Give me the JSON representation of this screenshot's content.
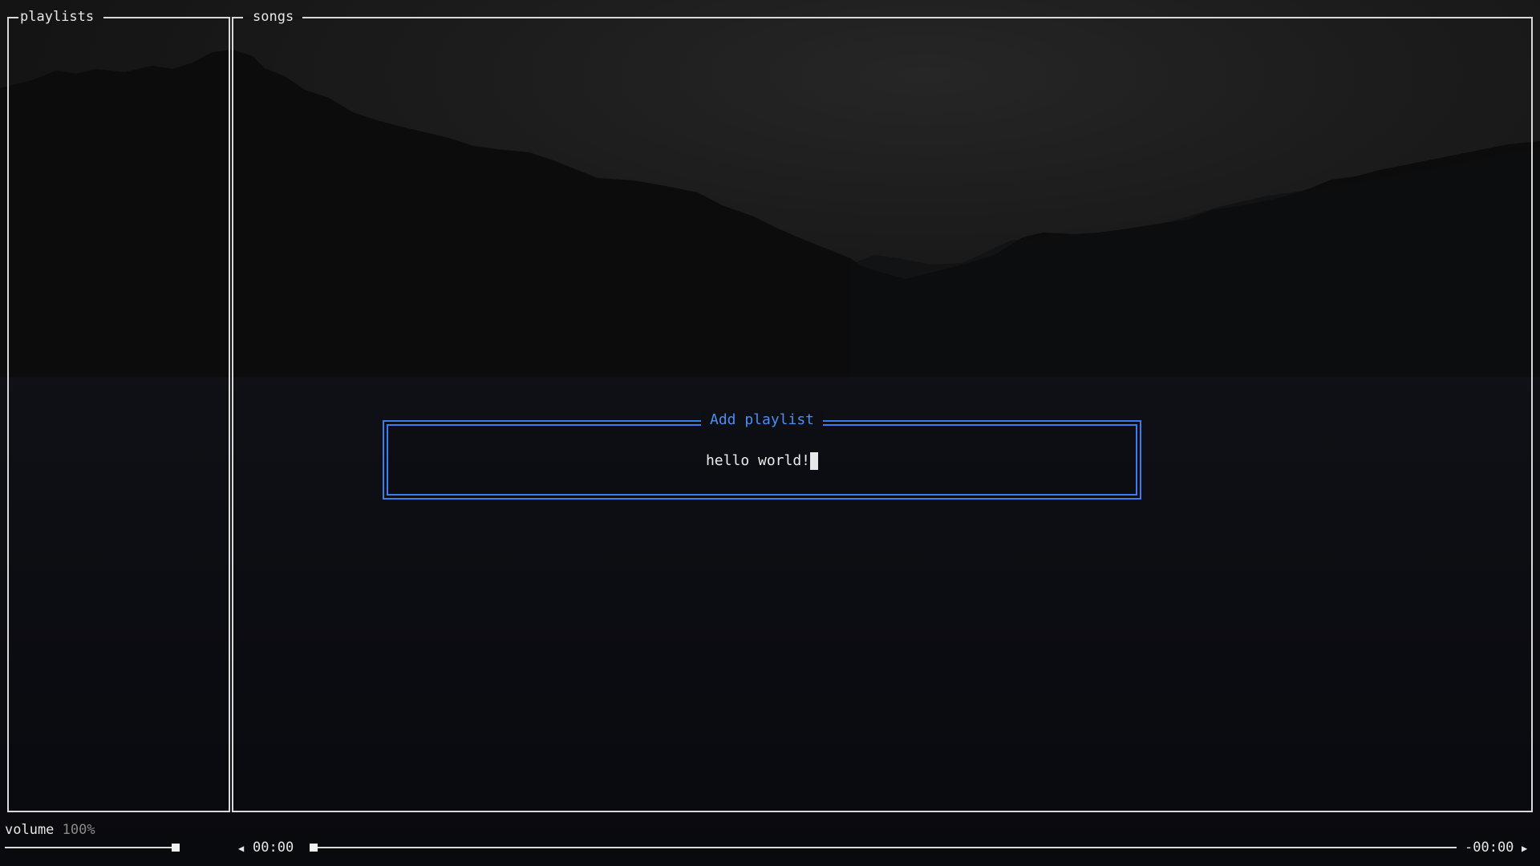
{
  "panels": {
    "playlists_title": "playlists",
    "songs_title": "songs"
  },
  "dialog": {
    "title": "Add playlist",
    "input_value": "hello world!"
  },
  "player": {
    "volume_label": "volume",
    "volume_value": "100%",
    "volume_level": 1.0,
    "elapsed": "00:00",
    "remaining": "-00:00",
    "progress": 0.0
  },
  "icons": {
    "prev": "caret-left-icon",
    "next": "caret-right-icon"
  },
  "colors": {
    "accent": "#3c7cf0",
    "border": "#d9d9d9",
    "text": "#e6e6e6",
    "muted": "#8a8a8a"
  }
}
